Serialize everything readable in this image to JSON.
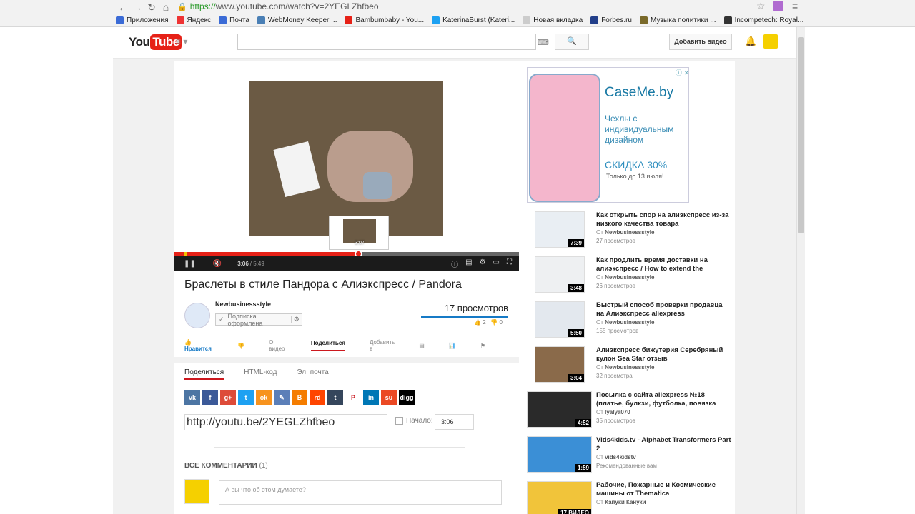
{
  "browser": {
    "url_scheme": "https://",
    "url_rest": "www.youtube.com/watch?v=2YEGLZhfbeo",
    "bookmarks": [
      {
        "label": "Приложения",
        "color": "#3b6bd6"
      },
      {
        "label": "Яндекс",
        "color": "#e33"
      },
      {
        "label": "Почта",
        "color": "#3b6bd6"
      },
      {
        "label": "WebMoney Keeper ...",
        "color": "#4a7fb5"
      },
      {
        "label": "Bambumbaby - You...",
        "color": "#e62117"
      },
      {
        "label": "KaterinaBurst (Kateri...",
        "color": "#1da1f2"
      },
      {
        "label": "Новая вкладка",
        "color": "#ccc"
      },
      {
        "label": "Forbes.ru",
        "color": "#223f8a"
      },
      {
        "label": "Музыка политики ...",
        "color": "#7a6a2a"
      },
      {
        "label": "Incompetech: Royal...",
        "color": "#333"
      }
    ],
    "bookmarks_more": "»"
  },
  "masthead": {
    "logo_you": "You",
    "logo_tube": "Tube",
    "upload_label": "Добавить видео"
  },
  "player": {
    "preview_time": "3:07",
    "current_time": "3:06",
    "duration": "/ 5:49",
    "progress_fraction": 0.533
  },
  "video": {
    "title": "Браслеты в стиле Пандора с Алиэкспресс / Pandora",
    "channel": "Newbusinessstyle",
    "subscribe_label": "Подписка оформлена",
    "views": "17 просмотров",
    "likes": "2",
    "dislikes": "0"
  },
  "actions": {
    "like": "Нравится",
    "about": "О видео",
    "share": "Поделиться",
    "add_to": "Добавить в"
  },
  "share": {
    "tabs": [
      "Поделиться",
      "HTML-код",
      "Эл. почта"
    ],
    "social": [
      {
        "label": "vk",
        "color": "#4c75a3"
      },
      {
        "label": "f",
        "color": "#3b5998"
      },
      {
        "label": "g+",
        "color": "#dd4b39"
      },
      {
        "label": "t",
        "color": "#1da1f2"
      },
      {
        "label": "ok",
        "color": "#f7931e"
      },
      {
        "label": "✎",
        "color": "#5b7fb8"
      },
      {
        "label": "B",
        "color": "#f57d00"
      },
      {
        "label": "rd",
        "color": "#ff4500"
      },
      {
        "label": "t",
        "color": "#35465c"
      },
      {
        "label": "P",
        "color": "#fff",
        "fg": "#cb2027"
      },
      {
        "label": "in",
        "color": "#0077b5"
      },
      {
        "label": "su",
        "color": "#eb4924"
      },
      {
        "label": "digg",
        "color": "#000"
      }
    ],
    "url": "http://youtu.be/2YEGLZhfbeo",
    "start_label": "Начало:",
    "start_value": "3:06"
  },
  "comments": {
    "header": "ВСЕ КОММЕНТАРИИ",
    "count": "(1)",
    "placeholder": "А вы что об этом думаете?"
  },
  "ad": {
    "brand": "CaseMe.by",
    "text": "Чехлы с индивидуальным дизайном",
    "sale": "СКИДКА 30%",
    "until": "Только до 13 июля!"
  },
  "related": [
    {
      "title": "Как открыть спор на алиэкспресс из-за низкого качества товара",
      "meta1": "От ",
      "author": "Newbusinessstyle",
      "meta2": "27 просмотров",
      "duration": "7:39"
    },
    {
      "title": "Как продлить время доставки на алиэкспресс / How to extend the",
      "meta1": "От ",
      "author": "Newbusinessstyle",
      "meta2": "26 просмотров",
      "duration": "3:48"
    },
    {
      "title": "Быстрый способ проверки продавца на Алиэкспресс aliexpress",
      "meta1": "От ",
      "author": "Newbusinessstyle",
      "meta2": "155 просмотров",
      "duration": "5:50"
    },
    {
      "title": "Алиэкспресс бижутерия Серебряный кулон Sea Star отзыв",
      "meta1": "От ",
      "author": "Newbusinessstyle",
      "meta2": "32 просмотра",
      "duration": "3:04"
    },
    {
      "title": "Посылка с сайта aliexpress №18 (платье, булкзи, футболка, повязка",
      "meta1": "От ",
      "author": "lyalya070",
      "meta2": "35 просмотров",
      "duration": "4:52"
    },
    {
      "title": "Vids4kids.tv - Alphabet Transformers Part 2",
      "meta1": "От ",
      "author": "vids4kidstv",
      "meta2": "Рекомендованные вам",
      "duration": "1:59"
    },
    {
      "title": "Рабочие, Пожарные и Космические машины от Thematica",
      "meta1": "От ",
      "author": "Капуки Кануки",
      "meta2": "",
      "duration": "17 ВИДЕО"
    }
  ]
}
